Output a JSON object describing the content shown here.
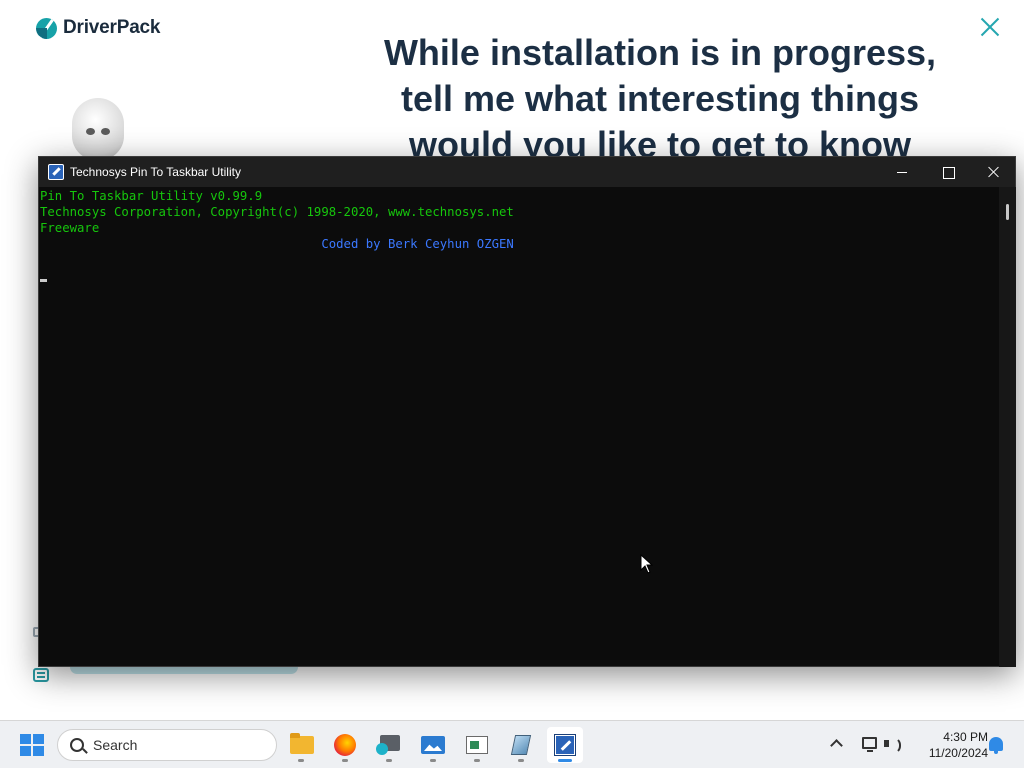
{
  "driverpack": {
    "brand": "DriverPack",
    "headline_lines": [
      "While installation is in progress,",
      "tell me what interesting things",
      "would you like to get to know"
    ]
  },
  "console": {
    "title": "Technosys Pin To Taskbar Utility",
    "lines": [
      "Pin To Taskbar Utility v0.99.9",
      "Technosys Corporation, Copyright(c) 1998-2020, www.technosys.net",
      "Freeware",
      "                                      Coded by Berk Ceyhun OZGEN"
    ],
    "colors": {
      "green": "#16c60c",
      "blue": "#3b78ff",
      "background": "#0c0c0c"
    }
  },
  "taskbar": {
    "search_placeholder": "Search",
    "apps": [
      {
        "icon": "file-explorer-icon"
      },
      {
        "icon": "firefox-icon"
      },
      {
        "icon": "network-manager-icon"
      },
      {
        "icon": "photos-icon"
      },
      {
        "icon": "document-icon"
      },
      {
        "icon": "tool-icon"
      },
      {
        "icon": "pin-to-taskbar-icon",
        "active": true
      }
    ],
    "clock": {
      "time": "4:30 PM",
      "date": "11/20/2024"
    },
    "accent": "#2f8ae6"
  }
}
